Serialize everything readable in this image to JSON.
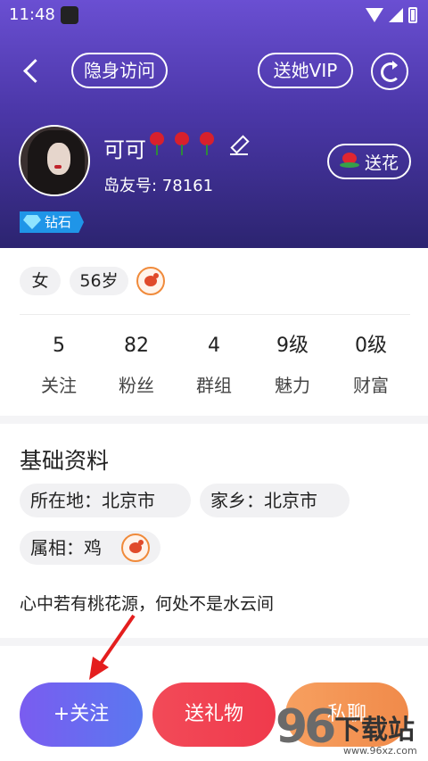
{
  "status_bar": {
    "time": "11:48"
  },
  "header": {
    "invisible_visit_label": "隐身访问",
    "send_vip_label": "送她VIP",
    "nickname": "可可",
    "user_id": "岛友号: 78161",
    "send_flower_label": "送花",
    "level_badge": "钻石"
  },
  "profile": {
    "gender": "女",
    "age": "56岁",
    "zodiac_icon": "rooster-icon"
  },
  "stats": [
    {
      "value": "5",
      "label": "关注"
    },
    {
      "value": "82",
      "label": "粉丝"
    },
    {
      "value": "4",
      "label": "群组"
    },
    {
      "value": "9级",
      "label": "魅力"
    },
    {
      "value": "0级",
      "label": "财富"
    }
  ],
  "basic_info": {
    "title": "基础资料",
    "location": "所在地：北京市",
    "hometown": "家乡：北京市",
    "zodiac": "属相：鸡",
    "signature": "心中若有桃花源，何处不是水云间"
  },
  "actions": {
    "follow_label": "+关注",
    "gift_label": "送礼物",
    "chat_label": "私聊"
  },
  "watermark": {
    "digits": "96",
    "text": "下载站",
    "url": "www.96xz.com"
  },
  "colors": {
    "header_top": "#6a4fd2",
    "header_bottom": "#2c2470",
    "follow": "#6a6af0",
    "gift": "#f24a58",
    "chat": "#f39454",
    "diamond": "#1f95e8",
    "annotation_arrow": "#e41e1e"
  }
}
